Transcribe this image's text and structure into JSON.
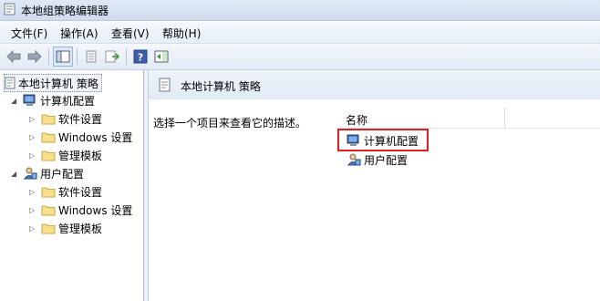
{
  "window": {
    "title": "本地组策略编辑器"
  },
  "menu": [
    "文件(F)",
    "操作(A)",
    "查看(V)",
    "帮助(H)"
  ],
  "toolbar": {
    "icons": [
      "back-arrow-icon",
      "forward-arrow-icon",
      "show-hide-tree-icon",
      "properties-icon",
      "export-list-icon",
      "help-icon",
      "action-pane-icon"
    ]
  },
  "tree": {
    "root": "本地计算机 策略",
    "computer": {
      "label": "计算机配置",
      "children": [
        "软件设置",
        "Windows 设置",
        "管理模板"
      ]
    },
    "user": {
      "label": "用户配置",
      "children": [
        "软件设置",
        "Windows 设置",
        "管理模板"
      ]
    }
  },
  "detail": {
    "header": "本地计算机 策略",
    "description": "选择一个项目来查看它的描述。",
    "column_name": "名称",
    "items": [
      "计算机配置",
      "用户配置"
    ],
    "highlight_color": "#e02020"
  }
}
